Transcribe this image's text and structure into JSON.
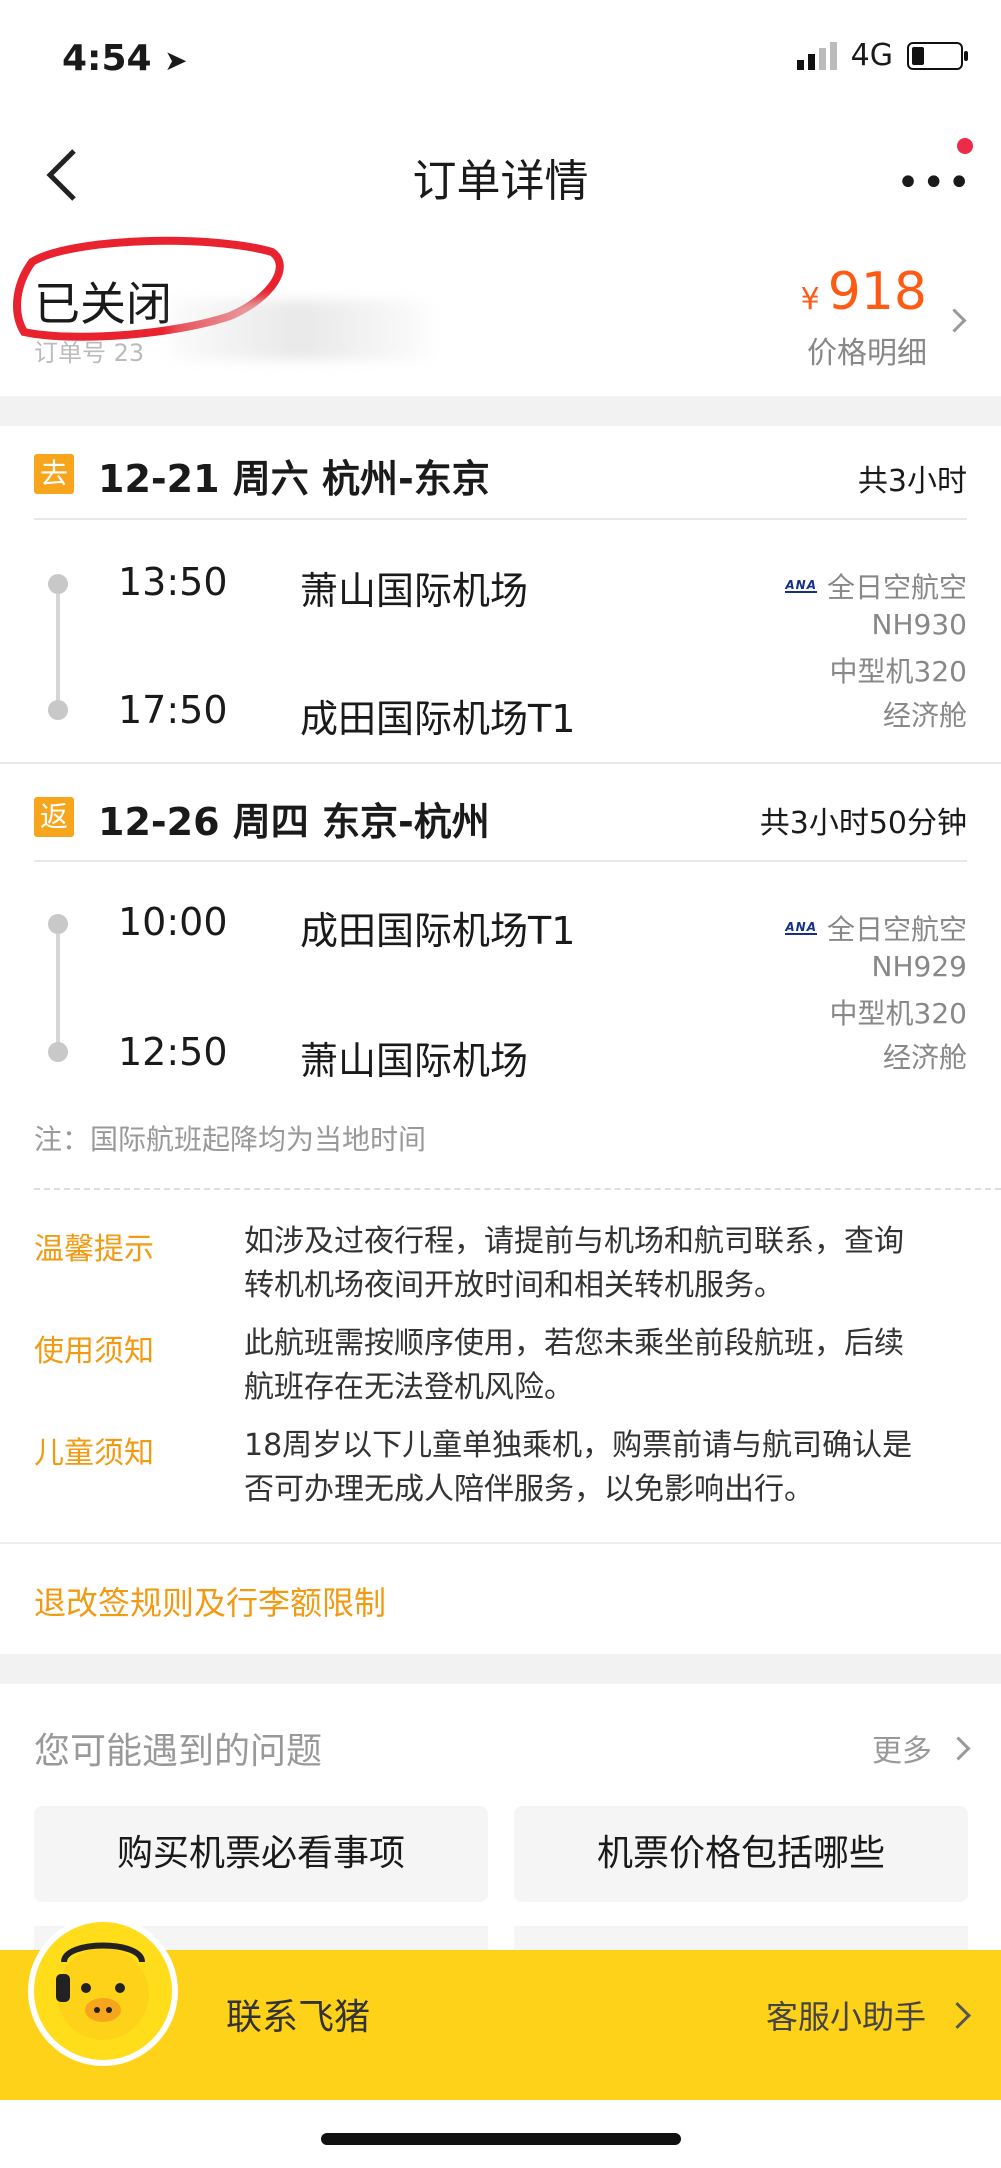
{
  "status_bar": {
    "time": "4:54",
    "network": "4G"
  },
  "nav": {
    "title": "订单详情"
  },
  "order": {
    "status": "已关闭",
    "number_label": "订单号 23",
    "currency": "¥",
    "price": "918",
    "price_detail": "价格明细"
  },
  "outbound": {
    "badge": "去",
    "date": "12-21",
    "weekday": "周六",
    "route": "杭州-东京",
    "duration": "共3小时",
    "depart_time": "13:50",
    "depart_airport": "萧山国际机场",
    "arrive_time": "17:50",
    "arrive_airport": "成田国际机场T1",
    "airline": "全日空航空",
    "airline_logo": "ANA",
    "flight_no": "NH930",
    "aircraft": "中型机320",
    "cabin": "经济舱"
  },
  "return": {
    "badge": "返",
    "date": "12-26",
    "weekday": "周四",
    "route": "东京-杭州",
    "duration": "共3小时50分钟",
    "depart_time": "10:00",
    "depart_airport": "成田国际机场T1",
    "arrive_time": "12:50",
    "arrive_airport": "萧山国际机场",
    "airline": "全日空航空",
    "airline_logo": "ANA",
    "flight_no": "NH929",
    "aircraft": "中型机320",
    "cabin": "经济舱"
  },
  "note": "注：国际航班起降均为当地时间",
  "tips": [
    {
      "label": "温馨提示",
      "lines": [
        "如涉及过夜行程，请提前与机场和航司联系，查询",
        "转机机场夜间开放时间和相关转机服务。"
      ]
    },
    {
      "label": "使用须知",
      "lines": [
        "此航班需按顺序使用，若您未乘坐前段航班，后续",
        "航班存在无法登机风险。"
      ]
    },
    {
      "label": "儿童须知",
      "lines": [
        "18周岁以下儿童单独乘机，购票前请与航司确认是",
        "否可办理无成人陪伴服务，以免影响出行。"
      ]
    }
  ],
  "rules_link": "退改签规则及行李额限制",
  "faq": {
    "title": "您可能遇到的问题",
    "more": "更多",
    "items": [
      "购买机票必看事项",
      "机票价格包括哪些"
    ]
  },
  "contact": {
    "label": "联系飞猪",
    "assistant": "客服小助手"
  },
  "colors": {
    "accent": "#f7a51c",
    "price": "#ff5a14",
    "bar": "#ffd21a"
  }
}
